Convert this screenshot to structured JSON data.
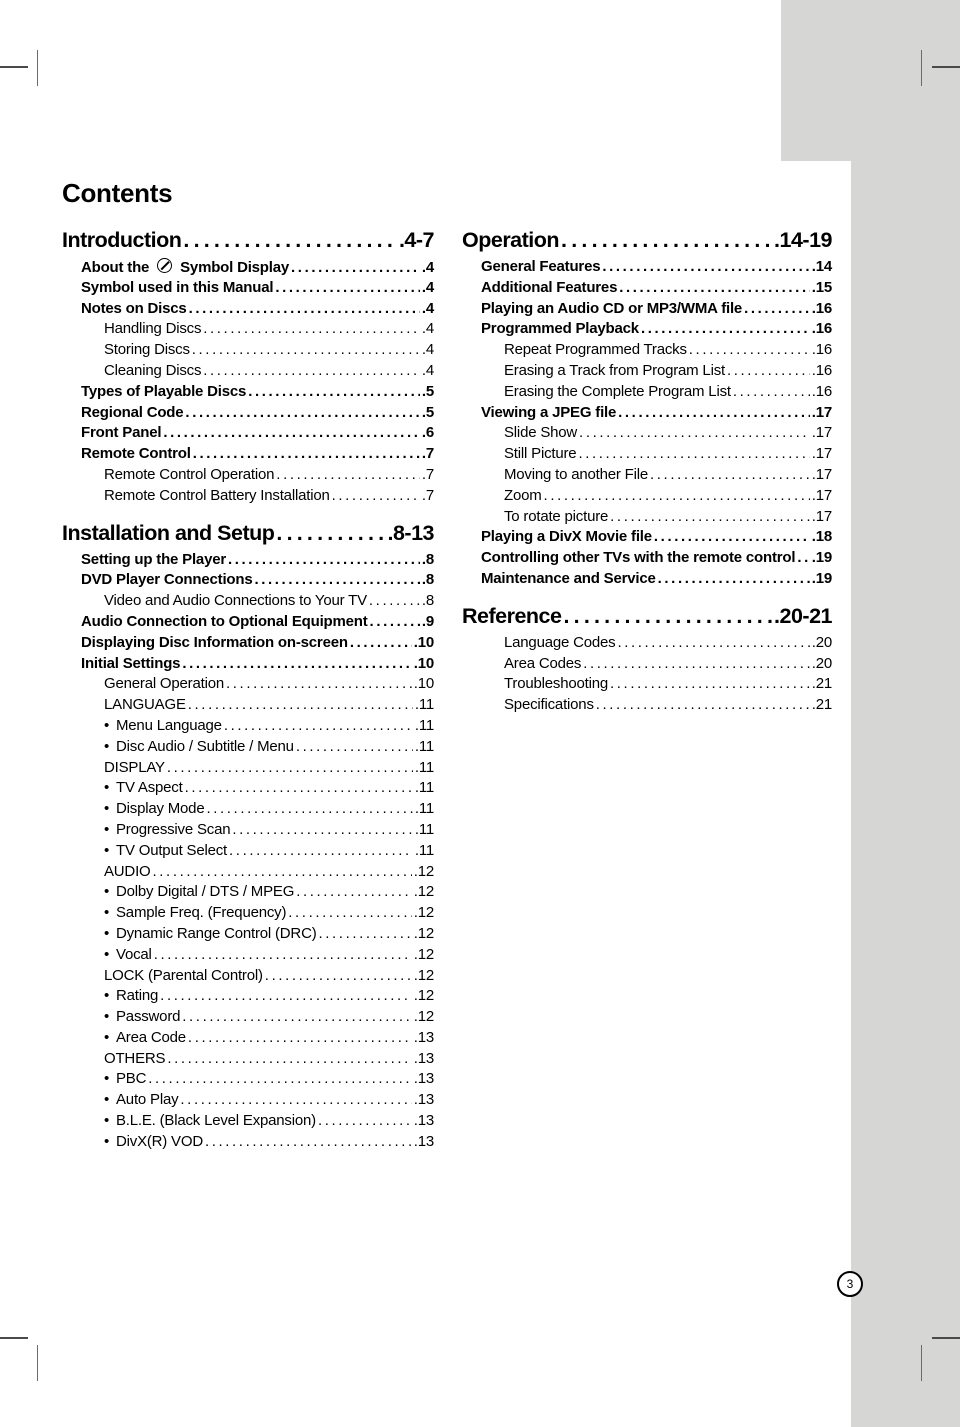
{
  "page": {
    "title": "Contents",
    "number": "3",
    "accent_grey": "#d6d6d4",
    "text_color": "#000000"
  },
  "left_column": [
    {
      "type": "section",
      "name": "introduction",
      "label": "Introduction",
      "page": ".4-7",
      "items": [
        {
          "level": 1,
          "label_pre": "About the",
          "symbol": "no-entry-slash-circle",
          "label_post": "Symbol Display",
          "label": "About the ⊘ Symbol Display",
          "page": ".4"
        },
        {
          "level": 1,
          "label": "Symbol used in this Manual",
          "page": ".4"
        },
        {
          "level": 1,
          "label": "Notes on Discs",
          "page": ".4"
        },
        {
          "level": 2,
          "label": "Handling Discs",
          "page": ".4"
        },
        {
          "level": 2,
          "label": "Storing Discs",
          "page": ".4"
        },
        {
          "level": 2,
          "label": "Cleaning Discs",
          "page": ".4"
        },
        {
          "level": 1,
          "label": "Types of Playable Discs",
          "page": ".5"
        },
        {
          "level": 1,
          "label": "Regional Code",
          "page": ".5"
        },
        {
          "level": 1,
          "label": "Front Panel",
          "page": ".6"
        },
        {
          "level": 1,
          "label": "Remote Control",
          "page": ".7"
        },
        {
          "level": 2,
          "label": "Remote Control Operation",
          "page": ".7"
        },
        {
          "level": 2,
          "label": "Remote Control Battery Installation",
          "page": ".7"
        }
      ]
    },
    {
      "type": "section",
      "name": "installation-and-setup",
      "label": "Installation and Setup",
      "page": ".8-13",
      "items": [
        {
          "level": 1,
          "label": "Setting up the Player",
          "page": ".8"
        },
        {
          "level": 1,
          "label": "DVD Player Connections",
          "page": ".8"
        },
        {
          "level": 2,
          "label": "Video and Audio Connections to Your TV",
          "page": ".8"
        },
        {
          "level": 1,
          "label": "Audio Connection to Optional Equipment",
          "page": ".9"
        },
        {
          "level": 1,
          "label": "Displaying Disc Information on-screen",
          "page": ".10"
        },
        {
          "level": 1,
          "label": "Initial Settings",
          "page": ".10"
        },
        {
          "level": 2,
          "label": "General Operation",
          "page": ".10"
        },
        {
          "level": 2,
          "label": "LANGUAGE",
          "page": ".11"
        },
        {
          "level": 2,
          "bullet": true,
          "label": "Menu Language",
          "page": ".11"
        },
        {
          "level": 2,
          "bullet": true,
          "label": "Disc Audio / Subtitle / Menu",
          "page": ".11"
        },
        {
          "level": 2,
          "label": "DISPLAY",
          "page": ".11"
        },
        {
          "level": 2,
          "bullet": true,
          "label": "TV Aspect",
          "page": ".11"
        },
        {
          "level": 2,
          "bullet": true,
          "label": "Display Mode",
          "page": ".11"
        },
        {
          "level": 2,
          "bullet": true,
          "label": "Progressive Scan",
          "page": ".11"
        },
        {
          "level": 2,
          "bullet": true,
          "label": "TV Output Select",
          "page": ".11"
        },
        {
          "level": 2,
          "label": "AUDIO",
          "page": ".12"
        },
        {
          "level": 2,
          "bullet": true,
          "label": "Dolby Digital / DTS / MPEG",
          "page": ".12"
        },
        {
          "level": 2,
          "bullet": true,
          "label": "Sample Freq. (Frequency)",
          "page": ".12"
        },
        {
          "level": 2,
          "bullet": true,
          "label": "Dynamic Range Control (DRC)",
          "page": ".12"
        },
        {
          "level": 2,
          "bullet": true,
          "label": "Vocal",
          "page": ".12"
        },
        {
          "level": 2,
          "label": "LOCK (Parental Control)",
          "page": ".12"
        },
        {
          "level": 2,
          "bullet": true,
          "label": "Rating",
          "page": ".12"
        },
        {
          "level": 2,
          "bullet": true,
          "label": "Password",
          "page": ".12"
        },
        {
          "level": 2,
          "bullet": true,
          "label": "Area Code",
          "page": ".13"
        },
        {
          "level": 2,
          "label": "OTHERS",
          "page": ".13"
        },
        {
          "level": 2,
          "bullet": true,
          "label": "PBC",
          "page": ".13"
        },
        {
          "level": 2,
          "bullet": true,
          "label": "Auto Play",
          "page": ".13"
        },
        {
          "level": 2,
          "bullet": true,
          "label": "B.L.E. (Black Level Expansion)",
          "page": ".13"
        },
        {
          "level": 2,
          "bullet": true,
          "label": "DivX(R) VOD",
          "page": ".13"
        }
      ]
    }
  ],
  "right_column": [
    {
      "type": "section",
      "name": "operation",
      "label": "Operation",
      "page": ".14-19",
      "items": [
        {
          "level": 1,
          "label": "General Features",
          "page": ".14"
        },
        {
          "level": 1,
          "label": "Additional Features",
          "page": ".15"
        },
        {
          "level": 1,
          "label": "Playing an Audio CD or MP3/WMA file",
          "page": ".16"
        },
        {
          "level": 1,
          "label": "Programmed Playback",
          "page": ".16"
        },
        {
          "level": 2,
          "label": "Repeat Programmed Tracks",
          "page": ".16"
        },
        {
          "level": 2,
          "label": "Erasing a Track from Program List",
          "page": ".16"
        },
        {
          "level": 2,
          "label": "Erasing the Complete Program List",
          "page": ".16"
        },
        {
          "level": 1,
          "label": "Viewing a JPEG file",
          "page": ".17"
        },
        {
          "level": 2,
          "label": "Slide Show",
          "page": ".17"
        },
        {
          "level": 2,
          "label": "Still Picture",
          "page": ".17"
        },
        {
          "level": 2,
          "label": "Moving to another File",
          "page": ".17"
        },
        {
          "level": 2,
          "label": "Zoom",
          "page": ".17"
        },
        {
          "level": 2,
          "label": "To rotate picture",
          "page": ".17"
        },
        {
          "level": 1,
          "label": "Playing a DivX Movie file",
          "page": ".18"
        },
        {
          "level": 1,
          "label": "Controlling other TVs with the remote control",
          "page": ".19"
        },
        {
          "level": 1,
          "label": "Maintenance and Service",
          "page": ".19"
        }
      ]
    },
    {
      "type": "section",
      "name": "reference",
      "label": "Reference",
      "page": ".20-21",
      "items": [
        {
          "level": 2,
          "label": "Language Codes",
          "page": ".20"
        },
        {
          "level": 2,
          "label": "Area Codes",
          "page": ".20"
        },
        {
          "level": 2,
          "label": "Troubleshooting",
          "page": ".21"
        },
        {
          "level": 2,
          "label": "Specifications",
          "page": ".21"
        }
      ]
    }
  ]
}
